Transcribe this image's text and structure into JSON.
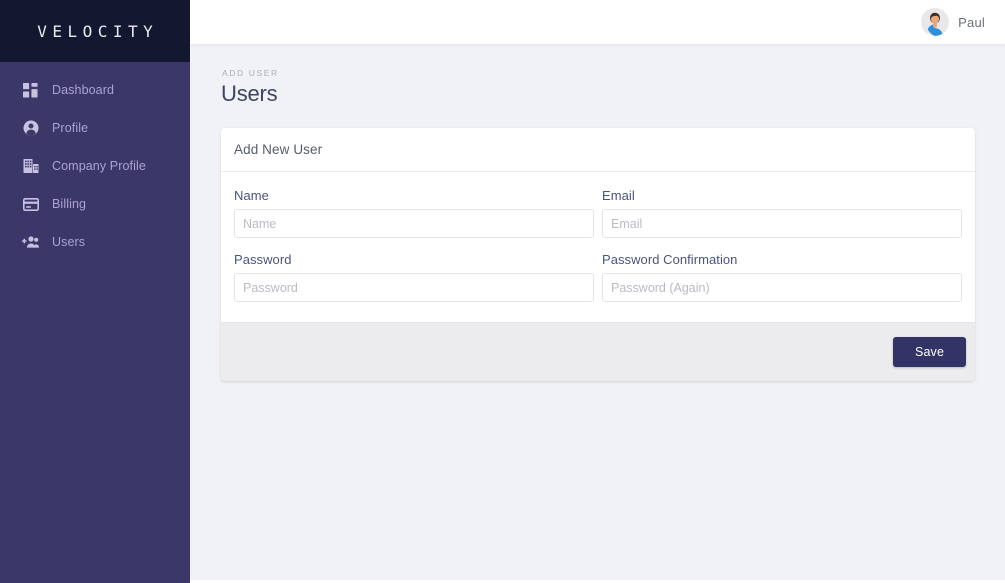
{
  "brand": {
    "logo_text": "VELOCITY"
  },
  "colors": {
    "sidebar_bg": "#3b3768",
    "sidebar_logo_bg": "#131830",
    "sidebar_label": "#a9a5d0",
    "content_bg": "#f1f2f5",
    "card_bg": "#ffffff",
    "card_footer_bg": "#ececee",
    "primary_button": "#343366",
    "page_title": "#3c4563",
    "form_label": "#4a5678",
    "placeholder": "#b9bcc4"
  },
  "sidebar": {
    "items": [
      {
        "label": "Dashboard",
        "icon": "dashboard-icon",
        "active": false
      },
      {
        "label": "Profile",
        "icon": "profile-icon",
        "active": false
      },
      {
        "label": "Company Profile",
        "icon": "company-icon",
        "active": false
      },
      {
        "label": "Billing",
        "icon": "billing-icon",
        "active": false
      },
      {
        "label": "Users",
        "icon": "users-add-icon",
        "active": false
      }
    ]
  },
  "topbar": {
    "user_name": "Paul",
    "avatar_icon": "user-avatar"
  },
  "page": {
    "breadcrumb": "ADD USER",
    "title": "Users"
  },
  "card": {
    "header_title": "Add New User",
    "fields": [
      {
        "label": "Name",
        "placeholder": "Name",
        "value": "",
        "type": "text",
        "name": "name"
      },
      {
        "label": "Email",
        "placeholder": "Email",
        "value": "",
        "type": "text",
        "name": "email"
      },
      {
        "label": "Password",
        "placeholder": "Password",
        "value": "",
        "type": "password",
        "name": "password"
      },
      {
        "label": "Password Confirmation",
        "placeholder": "Password (Again)",
        "value": "",
        "type": "password",
        "name": "password-confirmation"
      }
    ],
    "save_label": "Save"
  }
}
